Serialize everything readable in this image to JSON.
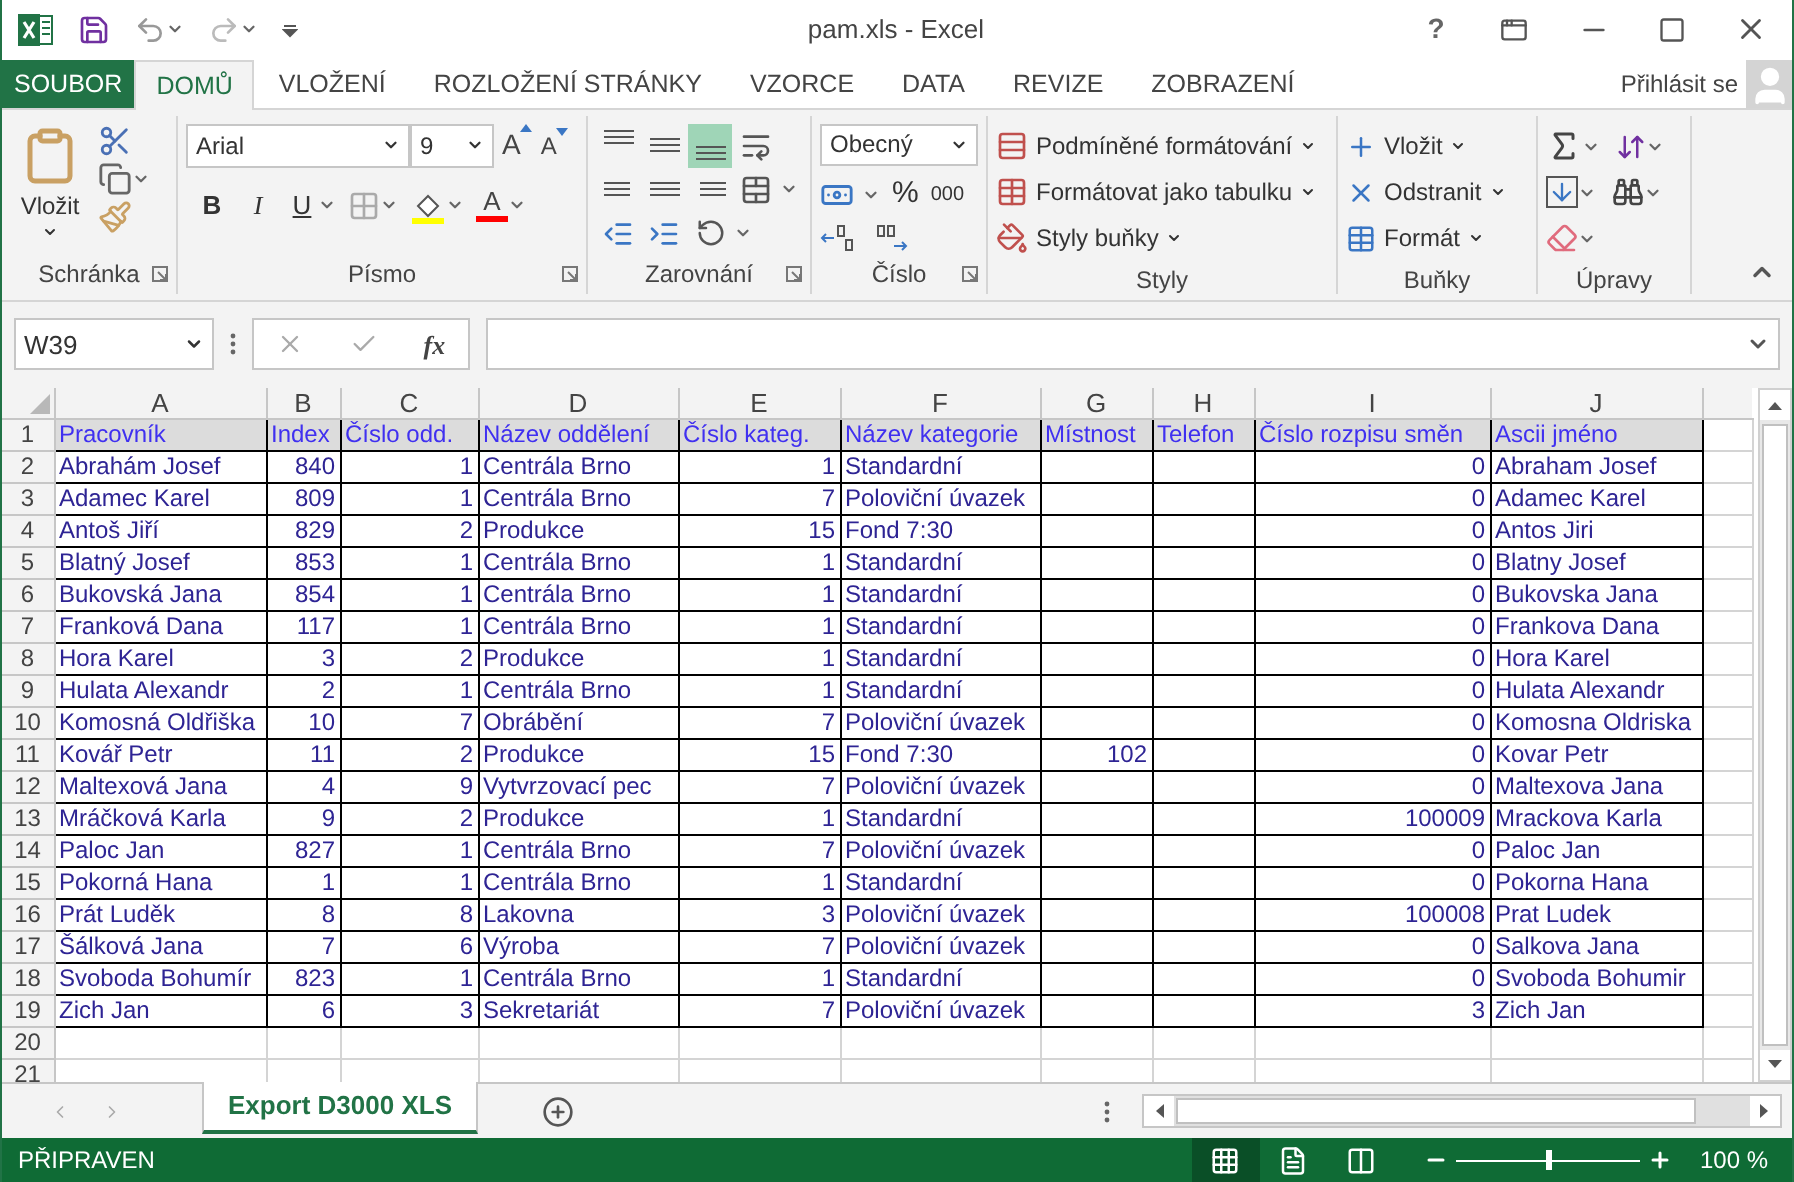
{
  "window": {
    "title": "pam.xls - Excel",
    "help": "?"
  },
  "tabs": [
    {
      "label": "SOUBOR",
      "kind": "file",
      "selected": false
    },
    {
      "label": "DOMŮ",
      "kind": "tab",
      "selected": true
    },
    {
      "label": "VLOŽENÍ",
      "kind": "tab",
      "selected": false
    },
    {
      "label": "ROZLOŽENÍ STRÁNKY",
      "kind": "tab",
      "selected": false
    },
    {
      "label": "VZORCE",
      "kind": "tab",
      "selected": false
    },
    {
      "label": "DATA",
      "kind": "tab",
      "selected": false
    },
    {
      "label": "REVIZE",
      "kind": "tab",
      "selected": false
    },
    {
      "label": "ZOBRAZENÍ",
      "kind": "tab",
      "selected": false
    }
  ],
  "account": {
    "label": "Přihlásit se"
  },
  "ribbon": {
    "clipboard": {
      "title": "Schránka",
      "paste": "Vložit"
    },
    "font": {
      "title": "Písmo",
      "family": "Arial",
      "size": "9",
      "grow": "A",
      "shrink": "A",
      "bold": "B",
      "italic": "I",
      "underline": "U",
      "font_color": "A"
    },
    "alignment": {
      "title": "Zarovnání",
      "vertical": [
        {
          "selected": false
        },
        {
          "selected": false
        },
        {
          "selected": true
        }
      ]
    },
    "number": {
      "title": "Číslo",
      "format": "Obecný",
      "percent": "%",
      "thousands": "000"
    },
    "styles": {
      "title": "Styly",
      "commands": [
        "Podmíněné formátování",
        "Formátovat jako tabulku",
        "Styly buňky"
      ]
    },
    "cells": {
      "title": "Buňky",
      "commands": [
        "Vložit",
        "Odstranit",
        "Formát"
      ]
    },
    "editing": {
      "title": "Úpravy"
    }
  },
  "formula_bar": {
    "name_box": "W39",
    "function_label": "fx"
  },
  "sheet": {
    "columns": [
      {
        "letter": "A",
        "numeric": false
      },
      {
        "letter": "B",
        "numeric": true
      },
      {
        "letter": "C",
        "numeric": true
      },
      {
        "letter": "D",
        "numeric": false
      },
      {
        "letter": "E",
        "numeric": true
      },
      {
        "letter": "F",
        "numeric": false
      },
      {
        "letter": "G",
        "numeric": true
      },
      {
        "letter": "H"
      },
      {
        "letter": "I",
        "numeric": true
      },
      {
        "letter": "J",
        "numeric": false
      }
    ],
    "rows": [
      {
        "number": "1",
        "kind": "header",
        "cells": {
          "A": "Pracovník",
          "B": "Index",
          "C": "Číslo odd.",
          "D": "Název oddělení",
          "E": "Číslo kateg.",
          "F": "Název kategorie",
          "G": "Místnost",
          "H": "Telefon",
          "I": "Číslo rozpisu směn",
          "J": "Ascii jméno"
        }
      },
      {
        "number": "2",
        "kind": "data",
        "cells": {
          "A": "Abrahám Josef",
          "B": "840",
          "C": "1",
          "D": "Centrála Brno",
          "E": "1",
          "F": "Standardní",
          "I": "0",
          "J": "Abraham Josef"
        }
      },
      {
        "number": "3",
        "kind": "data",
        "cells": {
          "A": "Adamec Karel",
          "B": "809",
          "C": "1",
          "D": "Centrála Brno",
          "E": "7",
          "F": "Poloviční úvazek",
          "I": "0",
          "J": "Adamec Karel"
        }
      },
      {
        "number": "4",
        "kind": "data",
        "cells": {
          "A": "Antoš Jiří",
          "B": "829",
          "C": "2",
          "D": "Produkce",
          "E": "15",
          "F": "Fond 7:30",
          "I": "0",
          "J": "Antos Jiri"
        }
      },
      {
        "number": "5",
        "kind": "data",
        "cells": {
          "A": "Blatný Josef",
          "B": "853",
          "C": "1",
          "D": "Centrála Brno",
          "E": "1",
          "F": "Standardní",
          "I": "0",
          "J": "Blatny Josef"
        }
      },
      {
        "number": "6",
        "kind": "data",
        "cells": {
          "A": "Bukovská Jana",
          "B": "854",
          "C": "1",
          "D": "Centrála Brno",
          "E": "1",
          "F": "Standardní",
          "I": "0",
          "J": "Bukovska Jana"
        }
      },
      {
        "number": "7",
        "kind": "data",
        "cells": {
          "A": "Franková Dana",
          "B": "117",
          "C": "1",
          "D": "Centrála Brno",
          "E": "1",
          "F": "Standardní",
          "I": "0",
          "J": "Frankova Dana"
        }
      },
      {
        "number": "8",
        "kind": "data",
        "cells": {
          "A": "Hora Karel",
          "B": "3",
          "C": "2",
          "D": "Produkce",
          "E": "1",
          "F": "Standardní",
          "I": "0",
          "J": "Hora Karel"
        }
      },
      {
        "number": "9",
        "kind": "data",
        "cells": {
          "A": "Hulata Alexandr",
          "B": "2",
          "C": "1",
          "D": "Centrála Brno",
          "E": "1",
          "F": "Standardní",
          "I": "0",
          "J": "Hulata Alexandr"
        }
      },
      {
        "number": "10",
        "kind": "data",
        "cells": {
          "A": "Komosná Oldřiška",
          "B": "10",
          "C": "7",
          "D": "Obrábění",
          "E": "7",
          "F": "Poloviční úvazek",
          "I": "0",
          "J": "Komosna Oldriska"
        }
      },
      {
        "number": "11",
        "kind": "data",
        "cells": {
          "A": "Kovář Petr",
          "B": "11",
          "C": "2",
          "D": "Produkce",
          "E": "15",
          "F": "Fond 7:30",
          "G": "102",
          "I": "0",
          "J": "Kovar Petr"
        }
      },
      {
        "number": "12",
        "kind": "data",
        "cells": {
          "A": "Maltexová Jana",
          "B": "4",
          "C": "9",
          "D": "Vytvrzovací pec",
          "E": "7",
          "F": "Poloviční úvazek",
          "I": "0",
          "J": "Maltexova Jana"
        }
      },
      {
        "number": "13",
        "kind": "data",
        "cells": {
          "A": "Mráčková Karla",
          "B": "9",
          "C": "2",
          "D": "Produkce",
          "E": "1",
          "F": "Standardní",
          "I": "100009",
          "J": "Mrackova Karla"
        }
      },
      {
        "number": "14",
        "kind": "data",
        "cells": {
          "A": "Paloc Jan",
          "B": "827",
          "C": "1",
          "D": "Centrála Brno",
          "E": "7",
          "F": "Poloviční úvazek",
          "I": "0",
          "J": "Paloc Jan"
        }
      },
      {
        "number": "15",
        "kind": "data",
        "cells": {
          "A": "Pokorná Hana",
          "B": "1",
          "C": "1",
          "D": "Centrála Brno",
          "E": "1",
          "F": "Standardní",
          "I": "0",
          "J": "Pokorna Hana"
        }
      },
      {
        "number": "16",
        "kind": "data",
        "cells": {
          "A": "Prát Luděk",
          "B": "8",
          "C": "8",
          "D": "Lakovna",
          "E": "3",
          "F": "Poloviční úvazek",
          "I": "100008",
          "J": "Prat Ludek"
        }
      },
      {
        "number": "17",
        "kind": "data",
        "cells": {
          "A": "Šálková Jana",
          "B": "7",
          "C": "6",
          "D": "Výroba",
          "E": "7",
          "F": "Poloviční úvazek",
          "I": "0",
          "J": "Salkova Jana"
        }
      },
      {
        "number": "18",
        "kind": "data",
        "cells": {
          "A": "Svoboda Bohumír",
          "B": "823",
          "C": "1",
          "D": "Centrála Brno",
          "E": "1",
          "F": "Standardní",
          "I": "0",
          "J": "Svoboda Bohumir"
        }
      },
      {
        "number": "19",
        "kind": "data",
        "cells": {
          "A": "Zich Jan",
          "B": "6",
          "C": "3",
          "D": "Sekretariát",
          "E": "7",
          "F": "Poloviční úvazek",
          "I": "3",
          "J": "Zich Jan"
        }
      },
      {
        "number": "20",
        "kind": "blank"
      },
      {
        "number": "21",
        "kind": "blank"
      }
    ]
  },
  "sheet_tabs": [
    {
      "label": "Export D3000 XLS",
      "selected": true
    }
  ],
  "status_bar": {
    "status": "PŘIPRAVEN",
    "views": [
      {
        "selected": true
      },
      {
        "selected": false
      },
      {
        "selected": false
      }
    ],
    "zoom_slider": {
      "level": 0.5
    },
    "zoom": "100 %"
  }
}
